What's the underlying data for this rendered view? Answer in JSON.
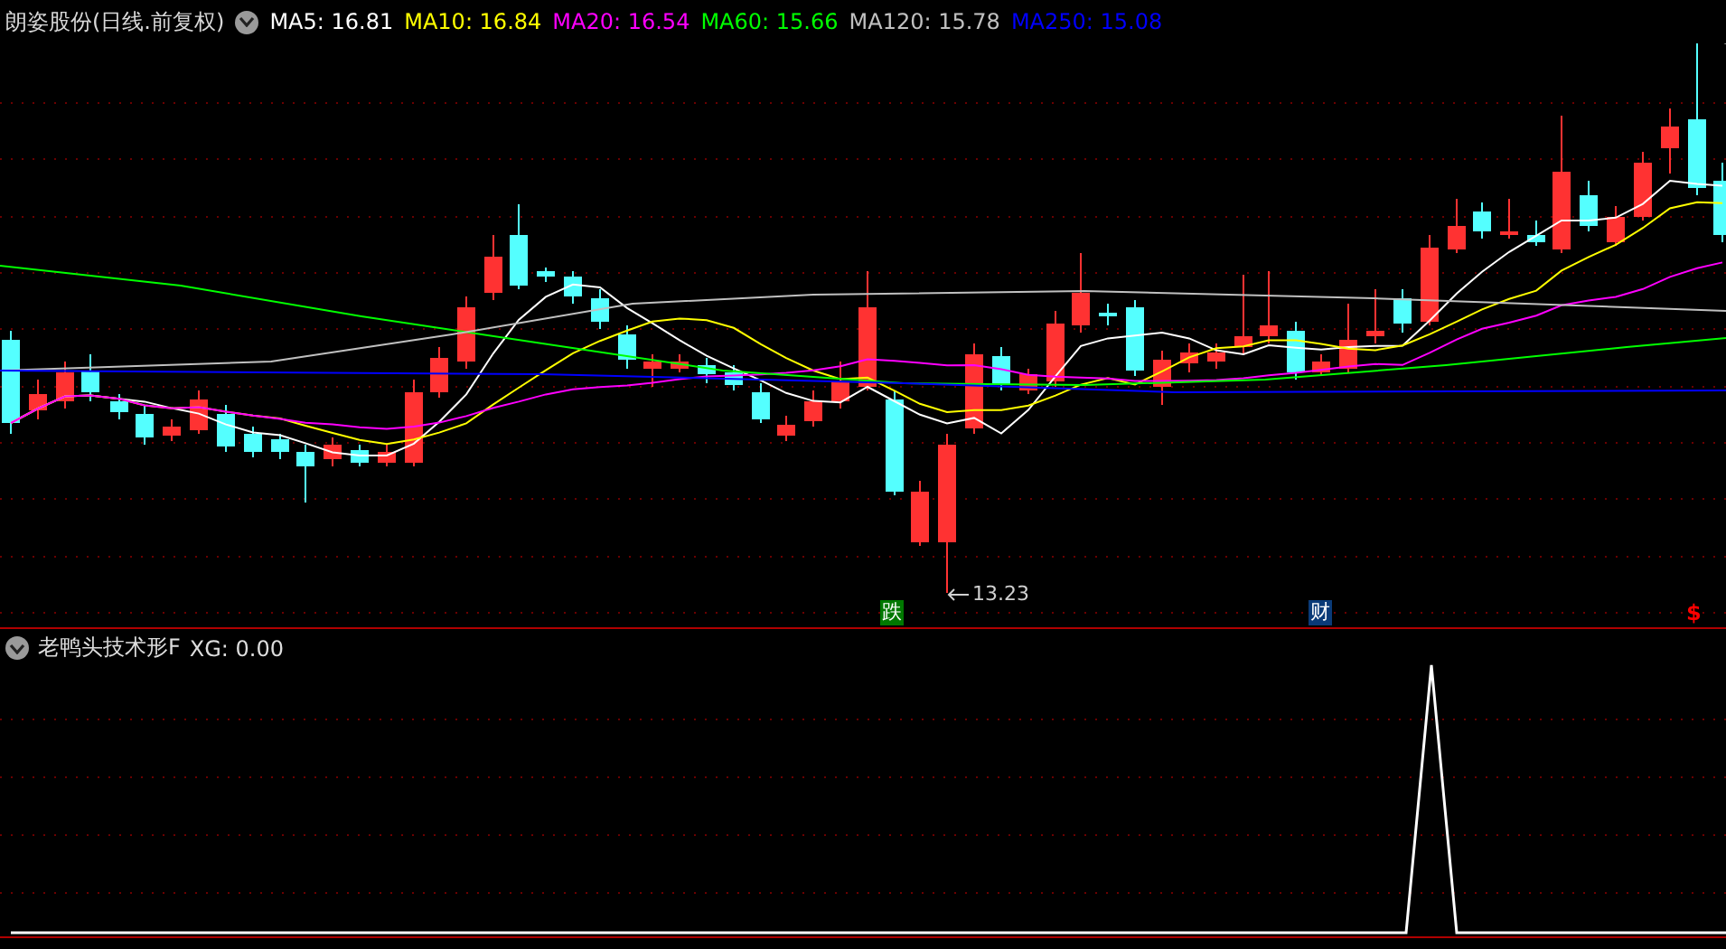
{
  "header": {
    "title": "朗姿股份(日线.前复权)",
    "ma_legend": [
      {
        "label": "MA5: 16.81",
        "color": "#ffffff"
      },
      {
        "label": "MA10: 16.84",
        "color": "#ffff00"
      },
      {
        "label": "MA20: 16.54",
        "color": "#ff00ff"
      },
      {
        "label": "MA60: 15.66",
        "color": "#00ff00"
      },
      {
        "label": "MA120: 15.78",
        "color": "#c0c0c0"
      },
      {
        "label": "MA250: 15.08",
        "color": "#0000ff"
      }
    ]
  },
  "main_chart": {
    "low_label": "13.23",
    "tags": [
      {
        "kind": "tag",
        "text": "跌",
        "color": "#007800"
      },
      {
        "kind": "tag",
        "text": "财",
        "color": "#0a3a78"
      },
      {
        "kind": "sign",
        "text": "$",
        "color": "#ff0000"
      }
    ]
  },
  "indicator": {
    "name": "老鸭头技术形F",
    "value": "XG: 0.00"
  }
}
